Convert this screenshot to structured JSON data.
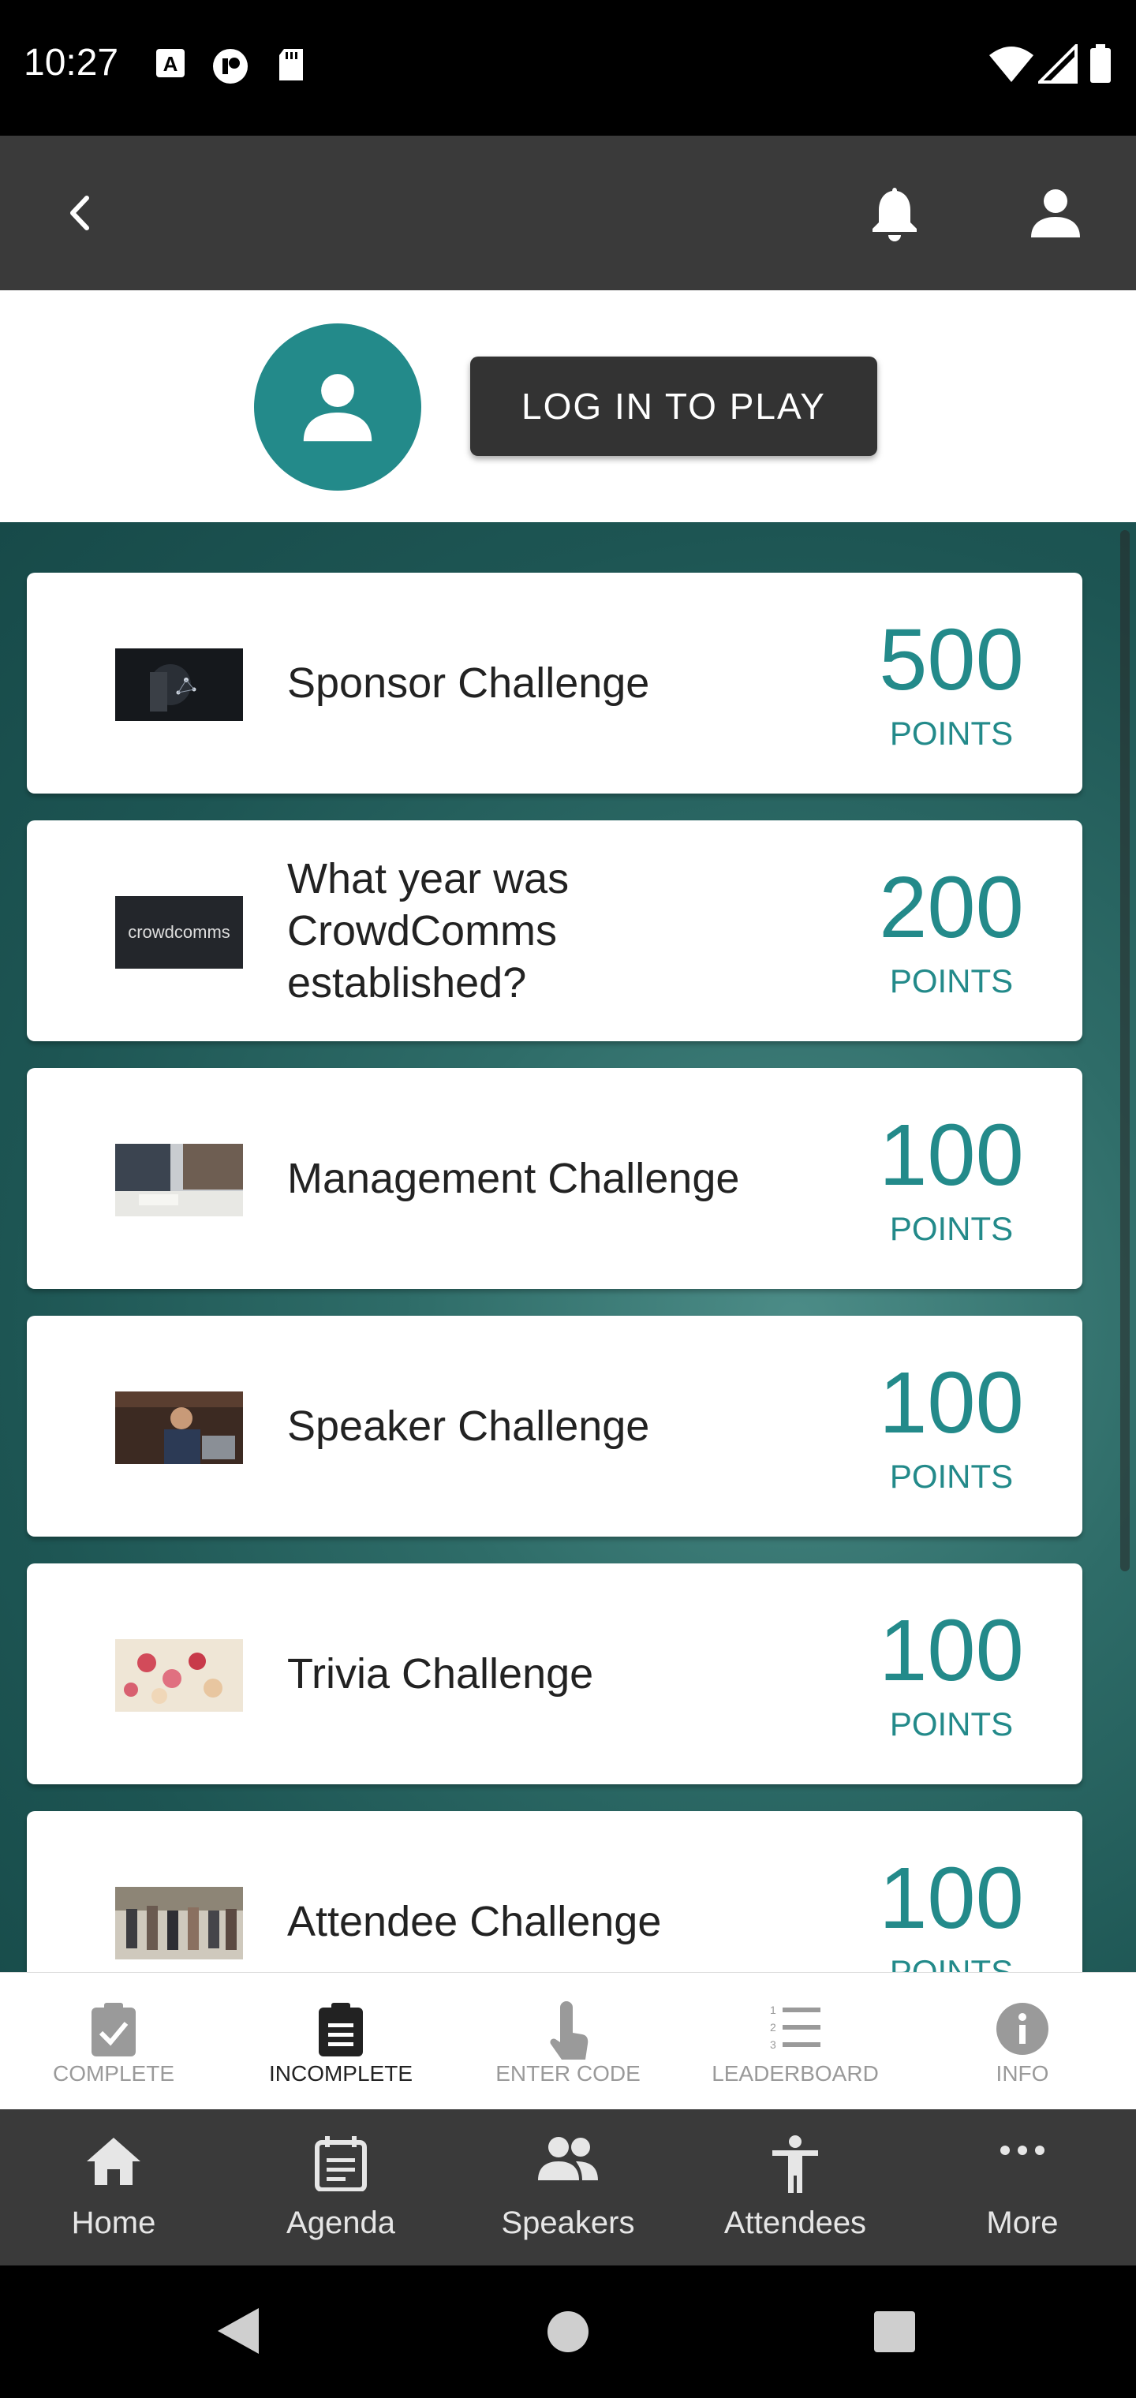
{
  "status_bar": {
    "time": "10:27"
  },
  "login": {
    "button_label": "LOG IN TO PLAY"
  },
  "challenges": [
    {
      "title": "Sponsor Challenge",
      "points": "500",
      "points_label": "POINTS"
    },
    {
      "title": "What year was CrowdComms established?",
      "points": "200",
      "points_label": "POINTS",
      "thumb_text": "crowdcomms"
    },
    {
      "title": "Management Challenge",
      "points": "100",
      "points_label": "POINTS"
    },
    {
      "title": "Speaker Challenge",
      "points": "100",
      "points_label": "POINTS"
    },
    {
      "title": "Trivia Challenge",
      "points": "100",
      "points_label": "POINTS"
    },
    {
      "title": "Attendee Challenge",
      "points": "100",
      "points_label": "POINTS"
    }
  ],
  "tabs": [
    {
      "label": "COMPLETE",
      "icon": "clipboard-check-icon"
    },
    {
      "label": "INCOMPLETE",
      "icon": "clipboard-list-icon",
      "active": true
    },
    {
      "label": "ENTER CODE",
      "icon": "touch-icon"
    },
    {
      "label": "LEADERBOARD",
      "icon": "numbered-list-icon"
    },
    {
      "label": "INFO",
      "icon": "info-icon"
    }
  ],
  "bottom_nav": [
    {
      "label": "Home",
      "icon": "home-icon"
    },
    {
      "label": "Agenda",
      "icon": "agenda-icon"
    },
    {
      "label": "Speakers",
      "icon": "speakers-icon"
    },
    {
      "label": "Attendees",
      "icon": "attendees-icon"
    },
    {
      "label": "More",
      "icon": "more-icon"
    }
  ],
  "colors": {
    "accent": "#238a8a",
    "app_bar": "#3a3a3a",
    "teal_bg": "#2e6c68"
  }
}
